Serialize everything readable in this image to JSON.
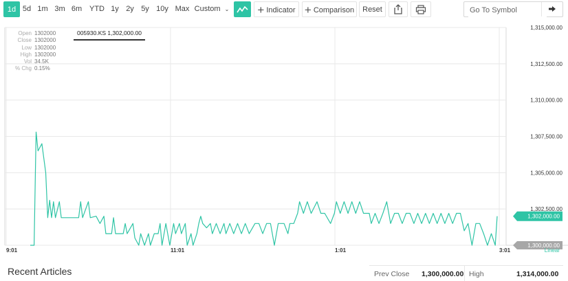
{
  "toolbar": {
    "ranges": [
      "1d",
      "5d",
      "1m",
      "3m",
      "6m",
      "YTD",
      "1y",
      "2y",
      "5y",
      "10y",
      "Max"
    ],
    "custom_label": "Custom",
    "indicator_label": "Indicator",
    "comparison_label": "Comparison",
    "reset_label": "Reset",
    "symbol_placeholder": "Go To Symbol"
  },
  "hud": {
    "open_label": "Open",
    "open": "1302000",
    "close_label": "Close",
    "close": "1302000",
    "low_label": "Low",
    "low": "1302000",
    "high_label": "High",
    "high": "1302000",
    "vol_label": "Vol",
    "vol": "34.5K",
    "chg_label": "% Chg",
    "chg": "0.15%"
  },
  "tooltip": "005930.KS 1,302,000.00",
  "colors": {
    "accent": "#2ec4a5",
    "grid": "#e8e8e8",
    "price_tag": "#2ec4a5",
    "prev_tag": "#a7a7a7"
  },
  "chart_data": {
    "type": "line",
    "y_ticks": [
      "1,315,000.00",
      "1,312,500.00",
      "1,310,000.00",
      "1,307,500.00",
      "1,305,000.00",
      "1,302,500.00",
      "1,300,000.00"
    ],
    "x_ticks": [
      "9:01",
      "11:01",
      "1:01",
      "3:01"
    ],
    "y_range": [
      1300000,
      1315000
    ],
    "current_price_label": "1,302,000.00",
    "prev_close_label": "1,300,000.00",
    "scale_label": "Linear",
    "series": [
      {
        "points": [
          [
            0,
            1300000
          ],
          [
            2,
            1300000
          ],
          [
            3,
            1307800
          ],
          [
            4,
            1306500
          ],
          [
            6,
            1307000
          ],
          [
            8,
            1305000
          ],
          [
            9,
            1301900
          ],
          [
            10,
            1303100
          ],
          [
            11,
            1301900
          ],
          [
            12,
            1303000
          ],
          [
            13,
            1301900
          ],
          [
            15,
            1303000
          ],
          [
            16,
            1301900
          ],
          [
            17,
            1301900
          ],
          [
            25,
            1301900
          ],
          [
            26,
            1303000
          ],
          [
            27,
            1301900
          ],
          [
            30,
            1303000
          ],
          [
            31,
            1301900
          ],
          [
            34,
            1302000
          ],
          [
            36,
            1301500
          ],
          [
            38,
            1302000
          ],
          [
            39,
            1300800
          ],
          [
            42,
            1300800
          ],
          [
            43,
            1301900
          ],
          [
            44,
            1300800
          ],
          [
            48,
            1300800
          ],
          [
            49,
            1301500
          ],
          [
            50,
            1300800
          ],
          [
            53,
            1301500
          ],
          [
            54,
            1300500
          ],
          [
            56,
            1300000
          ],
          [
            57,
            1300800
          ],
          [
            59,
            1300000
          ],
          [
            61,
            1300800
          ],
          [
            62,
            1300000
          ],
          [
            64,
            1300800
          ],
          [
            66,
            1300800
          ],
          [
            67,
            1301500
          ],
          [
            68,
            1300000
          ],
          [
            70,
            1301500
          ],
          [
            72,
            1300000
          ],
          [
            74,
            1301500
          ],
          [
            75,
            1300800
          ],
          [
            77,
            1301500
          ],
          [
            78,
            1300800
          ],
          [
            80,
            1301500
          ],
          [
            81,
            1300000
          ],
          [
            83,
            1300800
          ],
          [
            84,
            1300000
          ],
          [
            86,
            1300800
          ],
          [
            87,
            1301500
          ],
          [
            88,
            1302000
          ],
          [
            89,
            1301500
          ],
          [
            91,
            1301200
          ],
          [
            93,
            1301500
          ],
          [
            94,
            1300800
          ],
          [
            96,
            1301500
          ],
          [
            98,
            1300800
          ],
          [
            100,
            1301500
          ],
          [
            101,
            1300800
          ],
          [
            103,
            1301500
          ],
          [
            105,
            1300800
          ],
          [
            107,
            1301500
          ],
          [
            109,
            1300800
          ],
          [
            111,
            1301500
          ],
          [
            113,
            1300800
          ],
          [
            116,
            1301500
          ],
          [
            118,
            1301500
          ],
          [
            120,
            1300800
          ],
          [
            122,
            1301500
          ],
          [
            124,
            1301500
          ],
          [
            126,
            1300000
          ],
          [
            128,
            1301500
          ],
          [
            131,
            1301500
          ],
          [
            133,
            1300800
          ],
          [
            134,
            1301500
          ],
          [
            136,
            1301500
          ],
          [
            138,
            1302200
          ],
          [
            139,
            1303000
          ],
          [
            141,
            1302200
          ],
          [
            143,
            1303000
          ],
          [
            145,
            1302200
          ],
          [
            148,
            1303000
          ],
          [
            150,
            1302200
          ],
          [
            152,
            1302200
          ],
          [
            155,
            1301500
          ],
          [
            157,
            1302200
          ],
          [
            158,
            1303000
          ],
          [
            160,
            1302200
          ],
          [
            162,
            1303000
          ],
          [
            164,
            1302200
          ],
          [
            166,
            1303000
          ],
          [
            168,
            1302200
          ],
          [
            170,
            1303000
          ],
          [
            172,
            1302200
          ],
          [
            175,
            1302200
          ],
          [
            176,
            1301500
          ],
          [
            178,
            1302200
          ],
          [
            180,
            1301500
          ],
          [
            182,
            1302200
          ],
          [
            184,
            1303000
          ],
          [
            186,
            1301500
          ],
          [
            188,
            1302200
          ],
          [
            190,
            1302200
          ],
          [
            192,
            1301500
          ],
          [
            194,
            1302200
          ],
          [
            196,
            1302200
          ],
          [
            198,
            1301500
          ],
          [
            200,
            1302200
          ],
          [
            202,
            1301500
          ],
          [
            204,
            1302200
          ],
          [
            206,
            1301500
          ],
          [
            208,
            1302200
          ],
          [
            210,
            1301500
          ],
          [
            212,
            1302200
          ],
          [
            214,
            1301500
          ],
          [
            216,
            1302200
          ],
          [
            218,
            1301500
          ],
          [
            220,
            1302200
          ],
          [
            222,
            1302200
          ],
          [
            224,
            1301000
          ],
          [
            226,
            1301500
          ],
          [
            228,
            1300000
          ],
          [
            230,
            1301500
          ],
          [
            232,
            1301500
          ],
          [
            234,
            1300800
          ],
          [
            236,
            1300000
          ],
          [
            238,
            1300800
          ],
          [
            240,
            1300000
          ],
          [
            241,
            1302000
          ]
        ]
      }
    ]
  },
  "footer": {
    "recent_articles": "Recent Articles",
    "prev_close_label": "Prev Close",
    "prev_close_value": "1,300,000.00",
    "high_label": "High",
    "high_value": "1,314,000.00"
  }
}
